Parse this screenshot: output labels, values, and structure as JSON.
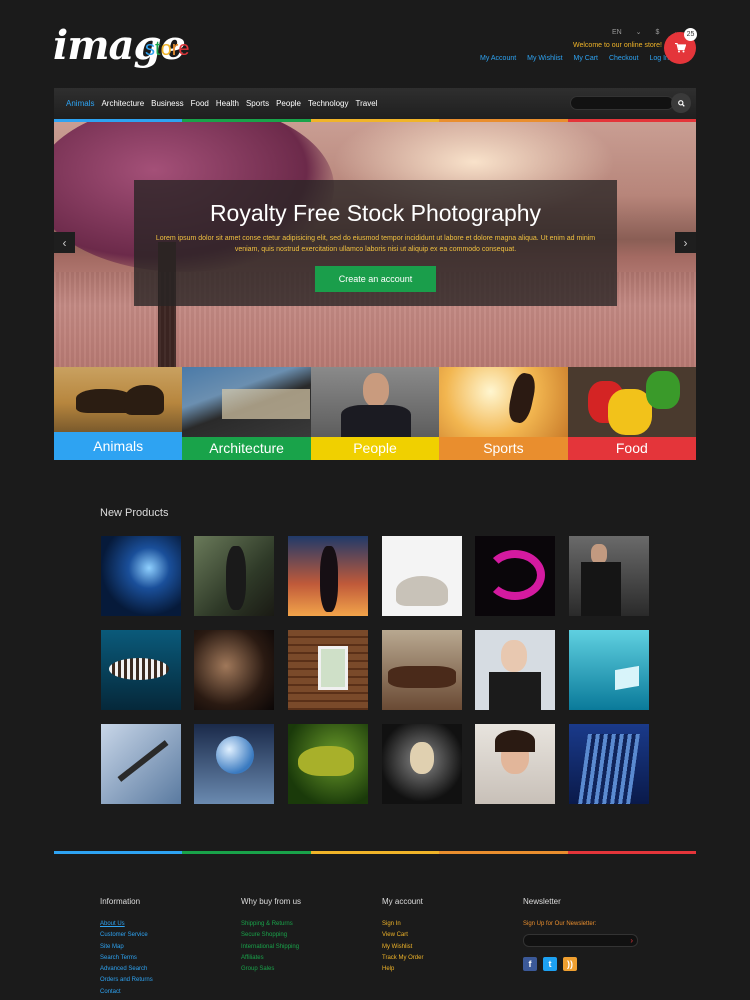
{
  "logo": {
    "image": "image",
    "store": [
      "s",
      "t",
      "o",
      "r",
      "e"
    ],
    "store_colors": [
      "#2ea3f2",
      "#19a34a",
      "#f0b429",
      "#e98e2e",
      "#e4353a"
    ]
  },
  "header": {
    "language": "EN",
    "currency": "$",
    "welcome": "Welcome to our online store!",
    "links": [
      "My Account",
      "My Wishlist",
      "My Cart",
      "Checkout",
      "Log In"
    ],
    "cart_count": "25",
    "cart_icon": "shopping-cart-icon"
  },
  "nav": {
    "items": [
      "Animals",
      "Architecture",
      "Business",
      "Food",
      "Health",
      "Sports",
      "People",
      "Technology",
      "Travel"
    ],
    "active": "Animals",
    "search_icon": "search-icon"
  },
  "stripe_colors": [
    "#2ea3f2",
    "#19a34a",
    "#f0b429",
    "#e98e2e",
    "#e4353a"
  ],
  "hero": {
    "title": "Royalty Free Stock Photography",
    "text": "Lorem ipsum dolor sit amet conse ctetur adipisicing elit, sed do eiusmod tempor incididunt ut labore et dolore magna aliqua. Ut enim ad minim veniam, quis nostrud exercitation ullamco laboris nisi ut aliquip ex ea commodo consequat.",
    "cta": "Create an account",
    "prev_icon": "chevron-left-icon",
    "next_icon": "chevron-right-icon"
  },
  "categories": [
    {
      "label": "Animals",
      "color": "#2ea3f2"
    },
    {
      "label": "Architecture",
      "color": "#19a34a"
    },
    {
      "label": "People",
      "color": "#f0d000"
    },
    {
      "label": "Sports",
      "color": "#e98e2e"
    },
    {
      "label": "Food",
      "color": "#e4353a"
    }
  ],
  "products": {
    "title": "New Products"
  },
  "footer": {
    "information": {
      "title": "Information",
      "links": [
        "About Us",
        "Customer Service",
        "Site Map",
        "Search Terms",
        "Advanced Search",
        "Orders and Returns",
        "Contact"
      ]
    },
    "why_buy": {
      "title": "Why buy from us",
      "links": [
        "Shipping & Returns",
        "Secure Shopping",
        "International Shipping",
        "Affiliates",
        "Group Sales"
      ]
    },
    "account": {
      "title": "My account",
      "links": [
        "Sign In",
        "View Cart",
        "My Wishlist",
        "Track My Order",
        "Help"
      ]
    },
    "newsletter": {
      "title": "Newsletter",
      "label": "Sign Up for Our Newsletter:",
      "social": [
        "facebook-icon",
        "twitter-icon",
        "rss-icon"
      ]
    }
  }
}
